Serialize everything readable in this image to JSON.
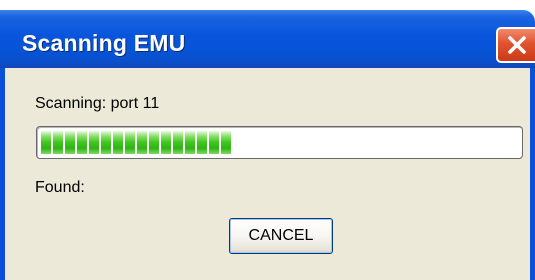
{
  "window": {
    "title": "Scanning EMU",
    "close_icon": "close-icon",
    "accent_color": "#0855dd",
    "close_color": "#e1532f"
  },
  "dialog": {
    "status_text": "Scanning: port 11",
    "progress": {
      "percent": 47,
      "fill_color": "#3ec61e",
      "segments_visible": 16
    },
    "found_label": "Found:",
    "cancel_label": "CANCEL"
  }
}
